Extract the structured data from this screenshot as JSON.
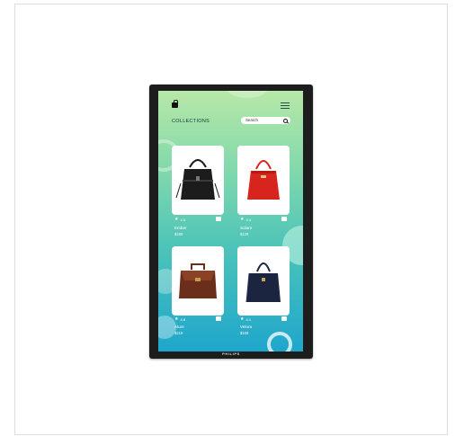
{
  "header": {
    "title": "COLLECTIONS"
  },
  "search": {
    "placeholder": "Search"
  },
  "products": [
    {
      "name": "Ember",
      "price": "$189",
      "rating": "4.5",
      "bag_color": "#1c1c1c"
    },
    {
      "name": "Solare",
      "price": "$129",
      "rating": "4.4",
      "bag_color": "#d8241f"
    },
    {
      "name": "Alure",
      "price": "$219",
      "rating": "4.8",
      "bag_color": "#6a2e1a"
    },
    {
      "name": "Velora",
      "price": "$169",
      "rating": "4.1",
      "bag_color": "#1c2540"
    }
  ],
  "monitor": {
    "brand": "PHILIPS"
  },
  "colors": {
    "gradient_top": "#b7e8a7",
    "gradient_bottom": "#1ea6cc",
    "card": "#ffffff"
  }
}
